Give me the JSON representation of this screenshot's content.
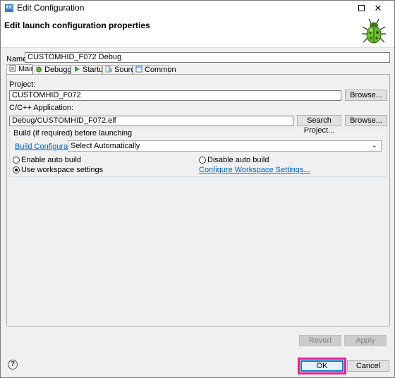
{
  "window": {
    "app_icon_text": "IDE",
    "title": "Edit Configuration",
    "maximize_icon": "maximize-icon",
    "close_glyph": "✕"
  },
  "header": {
    "title": "Edit launch configuration properties",
    "icon": "bug-icon"
  },
  "name": {
    "label": "Name:",
    "value": "CUSTOMHID_F072 Debug"
  },
  "tabs": [
    {
      "label": "Main",
      "icon": "main-tab-icon",
      "active": true
    },
    {
      "label": "Debugger",
      "icon": "debugger-icon",
      "active": false
    },
    {
      "label": "Startup",
      "icon": "startup-icon",
      "active": false
    },
    {
      "label": "Source",
      "icon": "source-icon",
      "active": false
    },
    {
      "label": "Common",
      "icon": "common-icon",
      "active": false
    }
  ],
  "main": {
    "project_label": "Project:",
    "project_value": "CUSTOMHID_F072",
    "project_browse": "Browse...",
    "app_label": "C/C++ Application:",
    "app_value": "Debug/CUSTOMHID_F072.elf",
    "search_project": "Search Project...",
    "app_browse": "Browse...",
    "build_group_label": "Build (if required) before launching",
    "build_config_link": "Build Configuration:",
    "build_config_value": "Select Automatically",
    "enable_auto_build": "Enable auto build",
    "disable_auto_build": "Disable auto build",
    "use_workspace_settings": "Use workspace settings",
    "configure_workspace_link": "Configure Workspace Settings...",
    "selected_radio": "use_workspace_settings"
  },
  "actions": {
    "revert": "Revert",
    "apply": "Apply",
    "ok": "OK",
    "cancel": "Cancel",
    "help_glyph": "?"
  },
  "colors": {
    "highlight": "#e91e8c",
    "link": "#0066cc",
    "focus": "#0078d7"
  }
}
